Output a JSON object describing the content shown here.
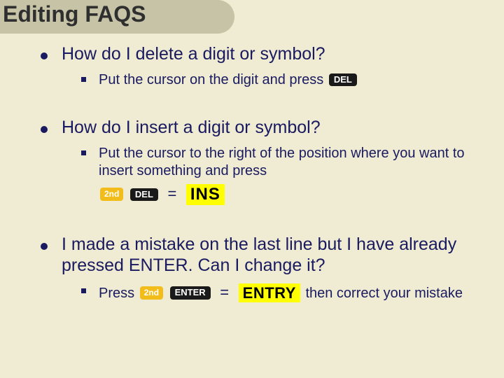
{
  "title": "Editing FAQS",
  "items": [
    {
      "question": "How do I delete a digit or symbol?",
      "answer_prefix": "Put the cursor on the digit and press",
      "keys_after": {
        "del": "DEL"
      }
    },
    {
      "question": "How do I insert a digit or symbol?",
      "answer_prefix": "Put the cursor to the right of the position where you want to insert something and press",
      "combo": {
        "second": "2nd",
        "del": "DEL",
        "equals": "=",
        "result": "INS"
      }
    },
    {
      "question": "I made a mistake on the last line but I have already pressed ENTER.  Can I change it?",
      "answer_prefix": "Press",
      "combo": {
        "second": "2nd",
        "enter": "ENTER",
        "equals": "=",
        "result": "ENTRY"
      },
      "answer_suffix": "then correct your mistake"
    }
  ]
}
